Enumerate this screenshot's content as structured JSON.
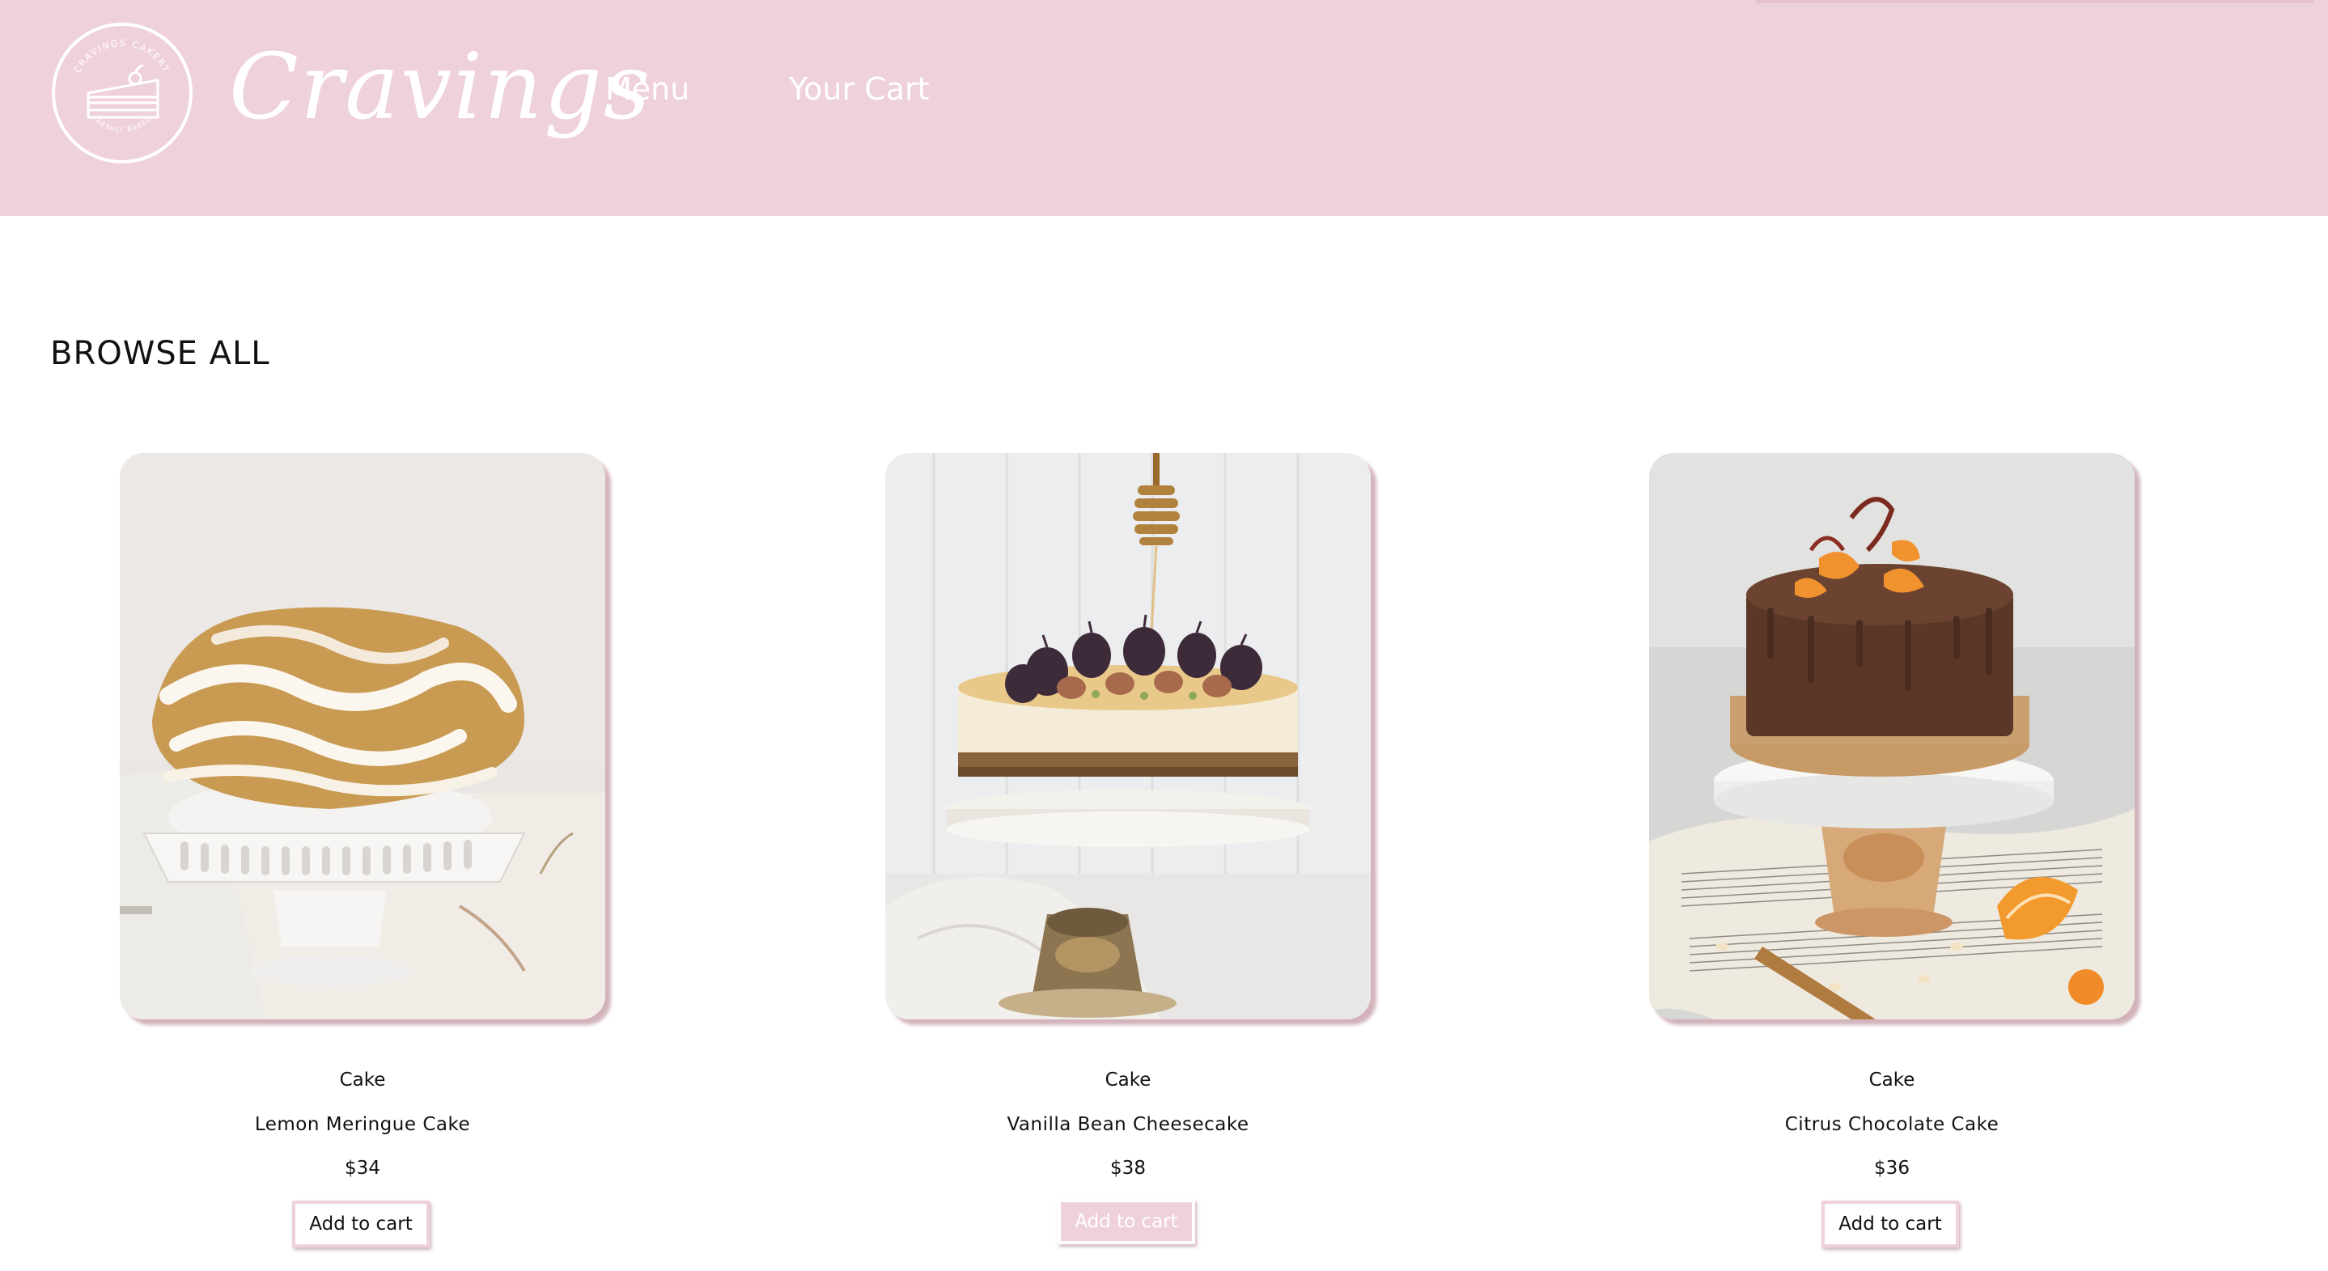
{
  "header": {
    "logo": {
      "ring_text_top": "CRAVINGS CAKERY",
      "ring_text_bottom": "FRESHLY BAKED",
      "icon": "cake-slice-icon"
    },
    "brand_name": "Cravings",
    "nav": [
      {
        "label": "Menu"
      },
      {
        "label": "Your Cart"
      }
    ]
  },
  "main": {
    "section_title": "BROWSE ALL",
    "products": [
      {
        "category": "Cake",
        "name": "Lemon Meringue Cake",
        "price": "$34",
        "button_label": "Add to cart",
        "button_state": "normal"
      },
      {
        "category": "Cake",
        "name": "Vanilla Bean Cheesecake",
        "price": "$38",
        "button_label": "Add to cart",
        "button_state": "hover"
      },
      {
        "category": "Cake",
        "name": "Citrus Chocolate Cake",
        "price": "$36",
        "button_label": "Add to cart",
        "button_state": "normal"
      }
    ]
  },
  "colors": {
    "header_bg": "#efd2d9",
    "accent_pink": "#efd2d9",
    "text": "#111111",
    "white": "#ffffff"
  }
}
